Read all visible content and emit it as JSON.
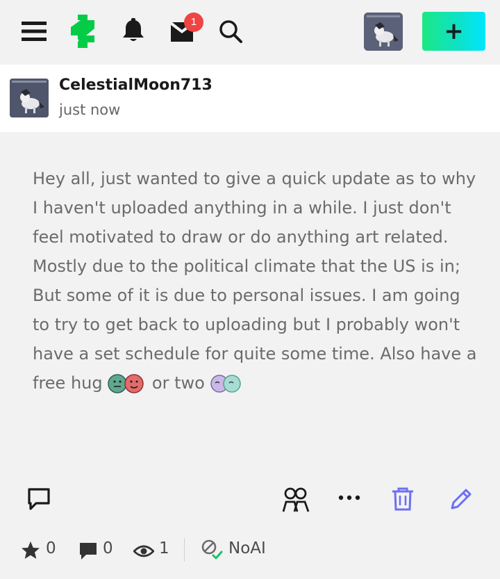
{
  "topbar": {
    "notifications_badge": "1",
    "create_label": "+"
  },
  "post": {
    "username": "CelestialMoon713",
    "timestamp": "just now",
    "text_main": "Hey all, just wanted to give a quick update as to why I haven't uploaded anything in a while. I just don't feel motivated to draw or do anything art related. Mostly due to the political climate that the US is in; But some of it is due to personal issues. I am going to try to get back to uploading but I probably won't have a set schedule for quite some time. Also have a free hug",
    "text_tail": "or two"
  },
  "stats": {
    "favourites": "0",
    "comments": "0",
    "views": "1",
    "noai_label": "NoAI"
  },
  "colors": {
    "brand_green": "#05cc47",
    "accent_blue_purple": "#6b6ff5",
    "badge_red": "#ef4444"
  },
  "icons": [
    "menu-icon",
    "deviantart-logo-icon",
    "bell-icon",
    "inbox-icon",
    "search-icon",
    "comment-icon",
    "group-icon",
    "more-icon",
    "trash-icon",
    "edit-icon",
    "star-icon",
    "comment-count-icon",
    "eye-icon",
    "noai-icon"
  ]
}
